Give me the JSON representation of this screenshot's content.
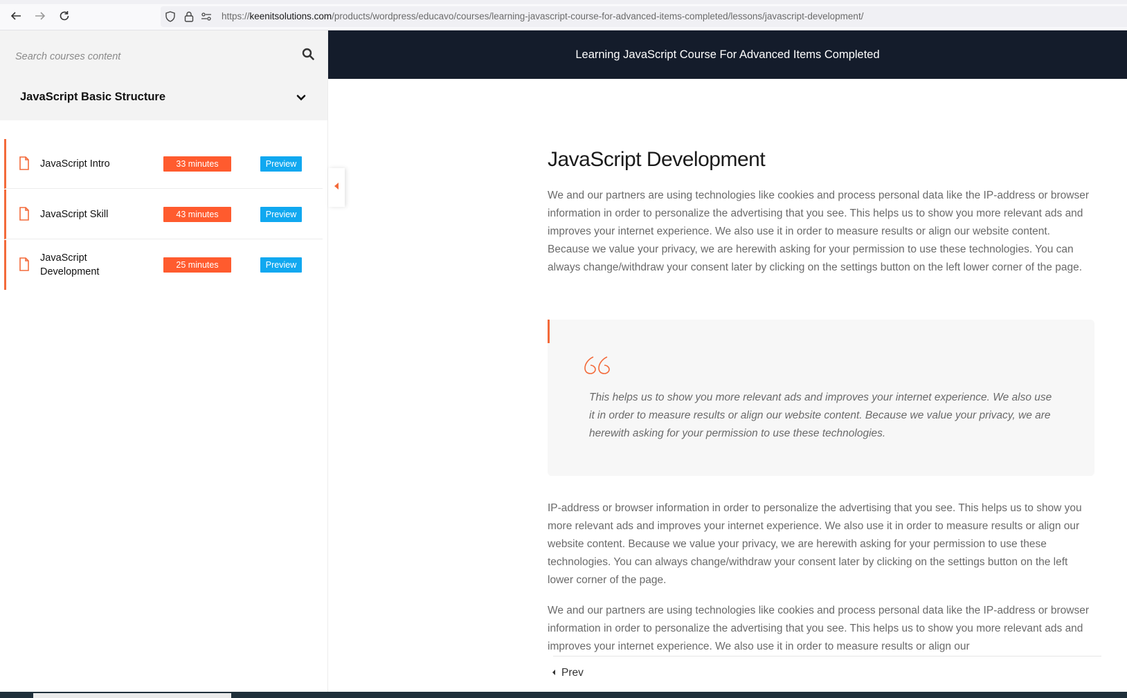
{
  "browser": {
    "url_prefix": "https://",
    "url_host": "keenitsolutions.com",
    "url_path": "/products/wordpress/educavo/courses/learning-javascript-course-for-advanced-items-completed/lessons/javascript-development/"
  },
  "sidebar": {
    "search_placeholder": "Search courses content",
    "section_title": "JavaScript Basic Structure",
    "lessons": [
      {
        "title": "JavaScript Intro",
        "duration": "33 minutes",
        "preview": "Preview"
      },
      {
        "title": "JavaScript Skill",
        "duration": "43 minutes",
        "preview": "Preview"
      },
      {
        "title": "JavaScript Development",
        "duration": "25 minutes",
        "preview": "Preview"
      }
    ]
  },
  "header": {
    "course_title": "Learning JavaScript Course For Advanced Items Completed"
  },
  "main": {
    "lesson_title": "JavaScript Development",
    "paragraph_1": "We and our partners are using technologies like cookies and process personal data like the IP-address or browser information in order to personalize the advertising that you see. This helps us to show you more relevant ads and improves your internet experience. We also use it in order to measure results or align our website content. Because we value your privacy, we are herewith asking for your permission to use these technologies. You can always change/withdraw your consent later by clicking on the settings button on the left lower corner of the page.",
    "quote": "This helps us to show you more relevant ads and improves your internet experience. We also use it in order to measure results or align our website content. Because we value your privacy, we are herewith asking for your permission to use these technologies.",
    "paragraph_2": "IP-address or browser information in order to personalize the advertising that you see. This helps us to show you more relevant ads and improves your internet experience. We also use it in order to measure results or align our website content. Because we value your privacy, we are herewith asking for your permission to use these technologies. You can always change/withdraw your consent later by clicking on the settings button on the left lower corner of the page.",
    "paragraph_3": "We and our partners are using technologies like cookies and process personal data like the IP-address or browser information in order to personalize the advertising that you see. This helps us to show you more relevant ads and improves your internet experience. We also use it in order to measure results or align our",
    "prev_label": "Prev"
  },
  "colors": {
    "accent": "#f36a3a",
    "duration_badge": "#ff5b2e",
    "preview_badge": "#10a8f0",
    "header_bg": "#141c2b"
  },
  "icons": [
    "back-arrow-icon",
    "forward-arrow-icon",
    "reload-icon",
    "shield-icon",
    "lock-icon",
    "permissions-icon",
    "search-icon",
    "chevron-down-icon",
    "document-icon",
    "caret-left-icon",
    "quote-icon"
  ]
}
